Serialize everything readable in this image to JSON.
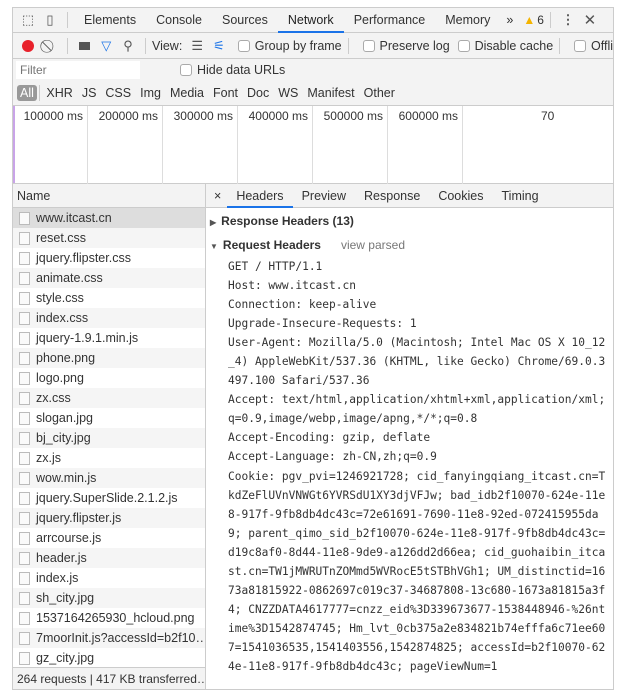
{
  "tabs": {
    "items": [
      "Elements",
      "Console",
      "Sources",
      "Network",
      "Performance",
      "Memory"
    ],
    "more": "»",
    "warnings": "6"
  },
  "toolbar": {
    "view_label": "View:",
    "group_by_frame": "Group by frame",
    "preserve_log": "Preserve log",
    "disable_cache": "Disable cache",
    "offline": "Offli"
  },
  "filter": {
    "placeholder": "Filter",
    "hide_data_urls": "Hide data URLs"
  },
  "types": [
    "All",
    "XHR",
    "JS",
    "CSS",
    "Img",
    "Media",
    "Font",
    "Doc",
    "WS",
    "Manifest",
    "Other"
  ],
  "timeline": {
    "ticks": [
      "100000 ms",
      "200000 ms",
      "300000 ms",
      "400000 ms",
      "500000 ms",
      "600000 ms",
      "70"
    ]
  },
  "names": {
    "header": "Name",
    "rows": [
      "www.itcast.cn",
      "reset.css",
      "jquery.flipster.css",
      "animate.css",
      "style.css",
      "index.css",
      "jquery-1.9.1.min.js",
      "phone.png",
      "logo.png",
      "zx.css",
      "slogan.jpg",
      "bj_city.jpg",
      "zx.js",
      "wow.min.js",
      "jquery.SuperSlide.2.1.2.js",
      "jquery.flipster.js",
      "arrcourse.js",
      "header.js",
      "index.js",
      "sh_city.jpg",
      "1537164265930_hcloud.png",
      "7moorInit.js?accessId=b2f10…",
      "gz_city.jpg"
    ],
    "footer": "264 requests | 417 KB transferred…"
  },
  "detail": {
    "close": "×",
    "tabs": [
      "Headers",
      "Preview",
      "Response",
      "Cookies",
      "Timing"
    ],
    "response_headers": "Response Headers (13)",
    "request_headers": "Request Headers",
    "view_parsed": "view parsed",
    "lines": [
      "GET / HTTP/1.1",
      "Host: www.itcast.cn",
      "Connection: keep-alive",
      "Upgrade-Insecure-Requests: 1",
      "User-Agent: Mozilla/5.0 (Macintosh; Intel Mac OS X 10_12",
      "_4) AppleWebKit/537.36 (KHTML, like Gecko) Chrome/69.0.3",
      "497.100 Safari/537.36",
      "Accept: text/html,application/xhtml+xml,application/xml;",
      "q=0.9,image/webp,image/apng,*/*;q=0.8",
      "Accept-Encoding: gzip, deflate",
      "Accept-Language: zh-CN,zh;q=0.9",
      "Cookie: pgv_pvi=1246921728; cid_fanyingqiang_itcast.cn=T",
      "kdZeFlUVnVNWGt6YVRSdU1XY3djVFJw; bad_idb2f10070-624e-11e",
      "8-917f-9fb8db4dc43c=72e61691-7690-11e8-92ed-072415955da",
      "9; parent_qimo_sid_b2f10070-624e-11e8-917f-9fb8db4dc43c=",
      "d19c8af0-8d44-11e8-9de9-a126dd2d66ea; cid_guohaibin_itca",
      "st.cn=TW1jMWRUTnZOMmd5WVRocE5tSTBhVGh1; UM_distinctid=16",
      "73a81815922-0862697c019c37-34687808-13c680-1673a81815a3f",
      "4; CNZZDATA4617777=cnzz_eid%3D339673677-1538448946-%26nt",
      "ime%3D1542874745; Hm_lvt_0cb375a2e834821b74efffa6c71ee60",
      "7=1541036535,1541403556,1542874825; accessId=b2f10070-62",
      "4e-11e8-917f-9fb8db4dc43c; pageViewNum=1"
    ]
  },
  "colors": {
    "accent": "#1a73e8",
    "record": "#e8212b",
    "warning": "#f4b400"
  }
}
